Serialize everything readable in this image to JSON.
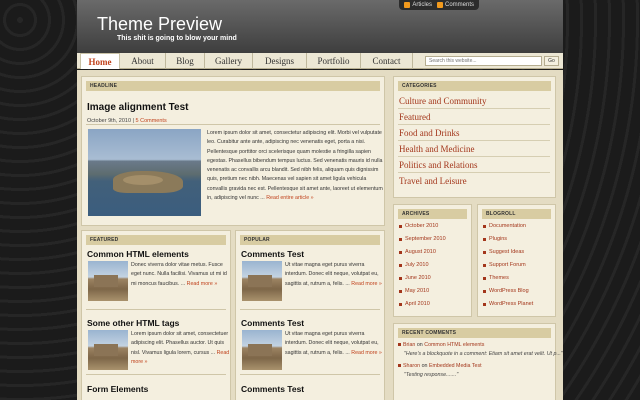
{
  "site": {
    "title": "Theme Preview",
    "tagline": "This shit is going to blow your mind"
  },
  "feeds": [
    {
      "label": "Articles",
      "icon": "rss-icon"
    },
    {
      "label": "Comments",
      "icon": "rss-icon"
    }
  ],
  "nav": [
    {
      "label": "Home",
      "active": true
    },
    {
      "label": "About"
    },
    {
      "label": "Blog"
    },
    {
      "label": "Gallery"
    },
    {
      "label": "Designs"
    },
    {
      "label": "Portfolio"
    },
    {
      "label": "Contact"
    }
  ],
  "search": {
    "placeholder": "Search this website...",
    "button": "Go"
  },
  "headline": {
    "section": "HEADLINE",
    "title": "Image alignment Test",
    "date": "October 9th, 2010",
    "separator": " | ",
    "comments": "5 Comments",
    "excerpt": "Lorem ipsum dolor sit amet, consectetur adipiscing elit. Morbi vel vulputate leo. Curabitur ante ante, adipiscing nec venenatis eget, porta a nisi. Pellentesque porttitor orci scelerisque quam molestie a fringilla sapien egestas. Phasellus bibendum tempus luctus. Sed venenatis mauris id nulla venenatis ac convallis arcu blandit. Sed nibh felis, aliquam quis dignissim quis, pretium nec nibh. Maecenas vel sapien sit amet ligula vehicula convallis gravida nec est. Pellentesque sit amet ante, laoreet ut elementum in, adipiscing vel nunc ...",
    "more": "Read entire article »"
  },
  "featured": {
    "section": "FEATURED",
    "posts": [
      {
        "title": "Common HTML elements",
        "excerpt": "Donec viverra dolor vitae metus. Fusce eget nunc. Nulla facilisi. Vivamus ut mi id mi moncus faucibus. ...",
        "more": "Read more »"
      },
      {
        "title": "Some other HTML tags",
        "excerpt": "Lorem ipsum dolor sit amet, consectetuer adipiscing elit. Phasellus auctor. Ut quis nisl. Vivamus ligula lorem, cursus ...",
        "more": "Read more »"
      },
      {
        "title": "Form Elements"
      }
    ]
  },
  "popular": {
    "section": "POPULAR",
    "posts": [
      {
        "title": "Comments Test",
        "excerpt": "Ut vitae magna eget purus viverra interdum. Donec elit neque, volutpat eu, sagittis at, rutrum a, felis. ...",
        "more": "Read more »"
      },
      {
        "title": "Comments Test",
        "excerpt": "Ut vitae magna eget purus viverra interdum. Donec elit neque, volutpat eu, sagittis at, rutrum a, felis. ...",
        "more": "Read more »"
      },
      {
        "title": "Comments Test"
      }
    ]
  },
  "categories": {
    "section": "CATEGORIES",
    "items": [
      "Culture and Community",
      "Featured",
      "Food and Drinks",
      "Health and Medicine",
      "Politics and Relations",
      "Travel and Leisure"
    ]
  },
  "archives": {
    "section": "ARCHIVES",
    "items": [
      "October 2010",
      "September 2010",
      "August 2010",
      "July 2010",
      "June 2010",
      "May 2010",
      "April 2010"
    ]
  },
  "blogroll": {
    "section": "BLOGROLL",
    "items": [
      "Documentation",
      "Plugins",
      "Suggest Ideas",
      "Support Forum",
      "Themes",
      "WordPress Blog",
      "WordPress Planet"
    ]
  },
  "recent_comments": {
    "section": "RECENT COMMENTS",
    "items": [
      {
        "author": "Brian",
        "on": "on",
        "post": "Common HTML elements",
        "quote": "\"Here's a blockquote in a comment: Etiam sit amet erat velit. Ut p...\""
      },
      {
        "author": "Sharon",
        "on": "on",
        "post": "Embedded Media Test",
        "quote": "\"Testing response.......\""
      }
    ]
  }
}
